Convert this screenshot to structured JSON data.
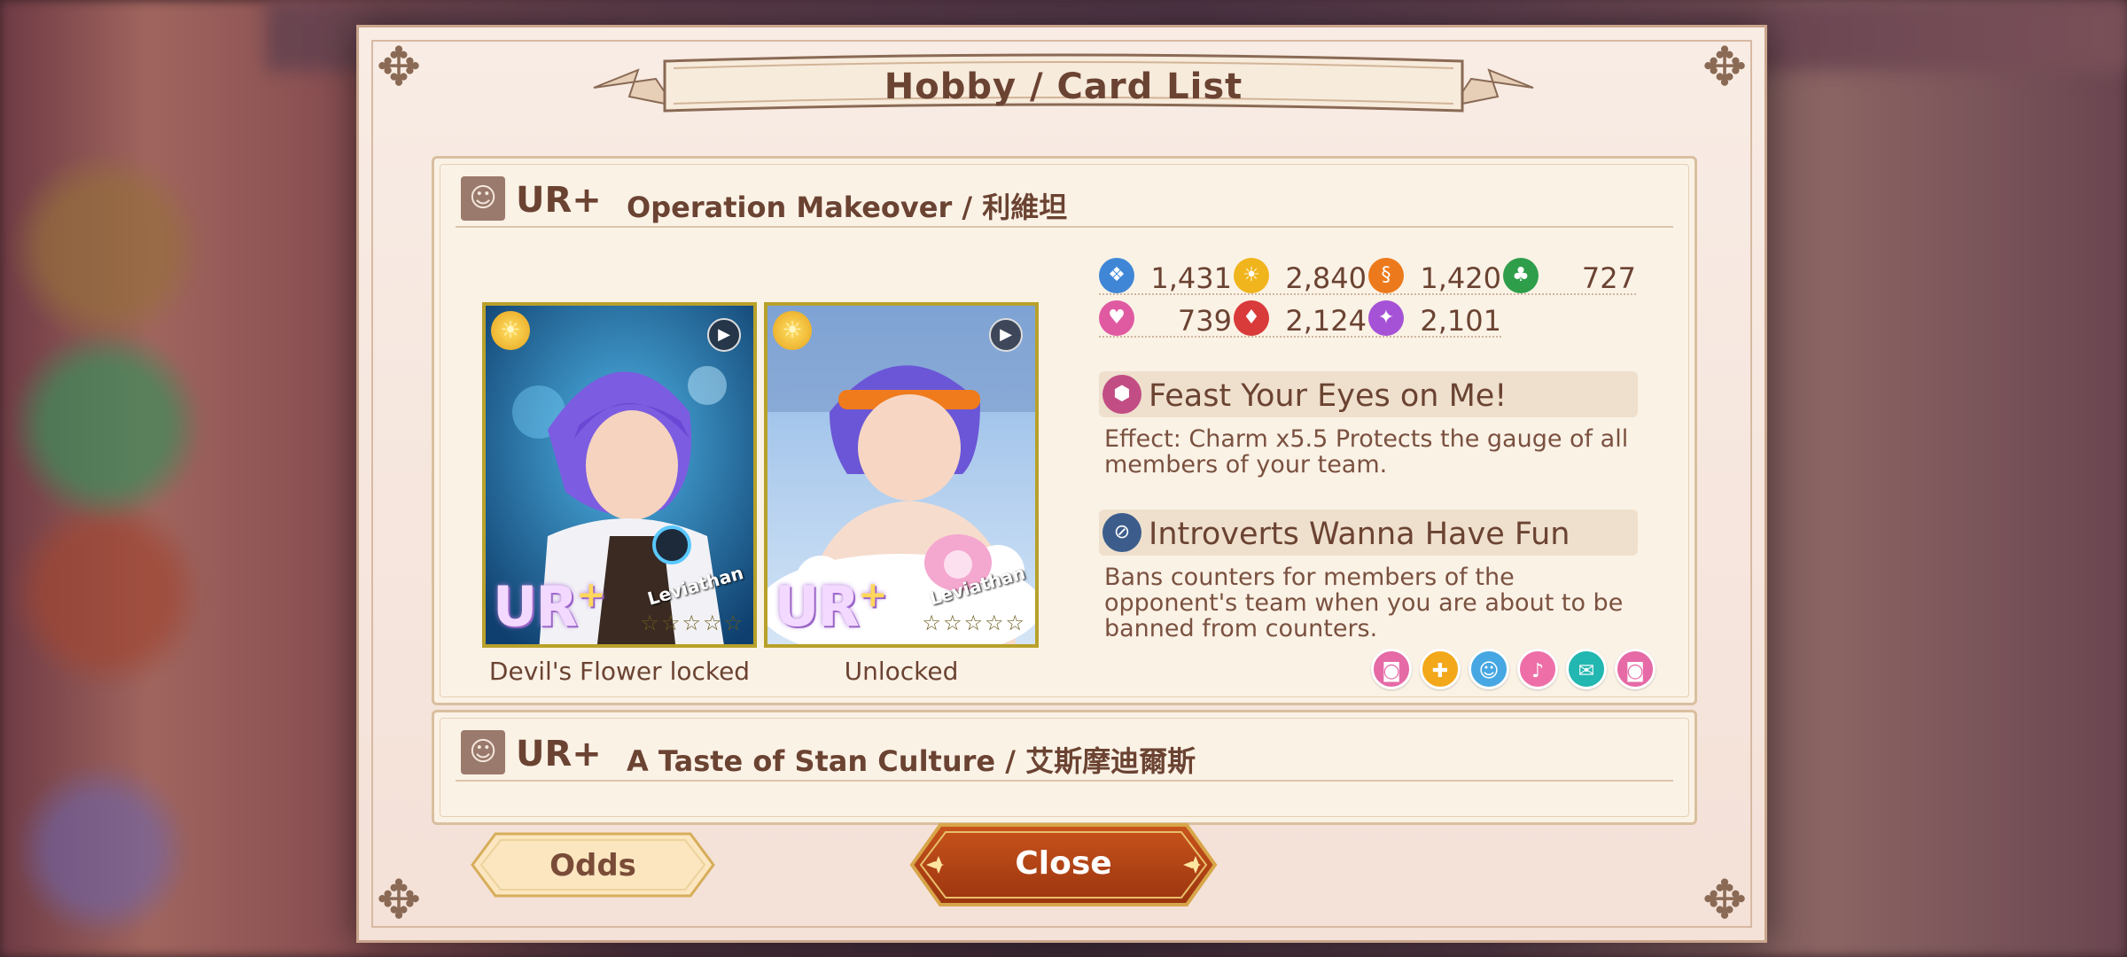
{
  "dialog": {
    "title": "Hobby / Card List"
  },
  "cards": [
    {
      "rarity": "UR+",
      "name": "Operation Makeover / 利維坦",
      "art": [
        {
          "character": "Leviathan",
          "caption": "Devil's Flower locked",
          "rarity_logo": "UR",
          "rarity_plus": "+",
          "stars": "☆☆☆☆☆"
        },
        {
          "character": "Leviathan",
          "caption": "Unlocked",
          "rarity_logo": "UR",
          "rarity_plus": "+",
          "stars": "☆☆☆☆☆"
        }
      ],
      "stats": [
        {
          "icon": "blue-attribute-icon",
          "color": "#3f87d6",
          "value": "1,431"
        },
        {
          "icon": "yellow-attribute-icon",
          "color": "#f0b51d",
          "value": "2,840"
        },
        {
          "icon": "orange-attribute-icon",
          "color": "#ec7a1c",
          "value": "1,420"
        },
        {
          "icon": "green-attribute-icon",
          "color": "#2e9e4a",
          "value": "727"
        },
        {
          "icon": "pink-attribute-icon",
          "color": "#e05aa2",
          "value": "739"
        },
        {
          "icon": "red-attribute-icon",
          "color": "#d93a3a",
          "value": "2,124"
        },
        {
          "icon": "purple-attribute-icon",
          "color": "#a552d6",
          "value": "2,101"
        }
      ],
      "skills": [
        {
          "name": "Feast Your Eyes on Me!",
          "description": "Effect: Charm x5.5 Protects the gauge of all members of your team.",
          "icon": "hexagon-skill-icon",
          "color": "#c24d84"
        },
        {
          "name": "Introverts Wanna Have Fun",
          "description": "Bans counters for members of the opponent's team when you are about to be banned from counters.",
          "icon": "ban-skill-icon",
          "color": "#3c5d8c"
        }
      ],
      "hobby_icons": [
        {
          "icon": "camera-icon",
          "color": "#e56aa6"
        },
        {
          "icon": "gift-icon",
          "color": "#f2a81a"
        },
        {
          "icon": "face-icon",
          "color": "#46a7e2"
        },
        {
          "icon": "microphone-icon",
          "color": "#ee6fa8"
        },
        {
          "icon": "chat-icon",
          "color": "#22b7b0"
        },
        {
          "icon": "camera-icon",
          "color": "#e56aa6"
        }
      ]
    },
    {
      "rarity": "UR+",
      "name": "A Taste of Stan Culture / 艾斯摩迪爾斯"
    }
  ],
  "buttons": {
    "odds": "Odds",
    "close": "Close"
  }
}
